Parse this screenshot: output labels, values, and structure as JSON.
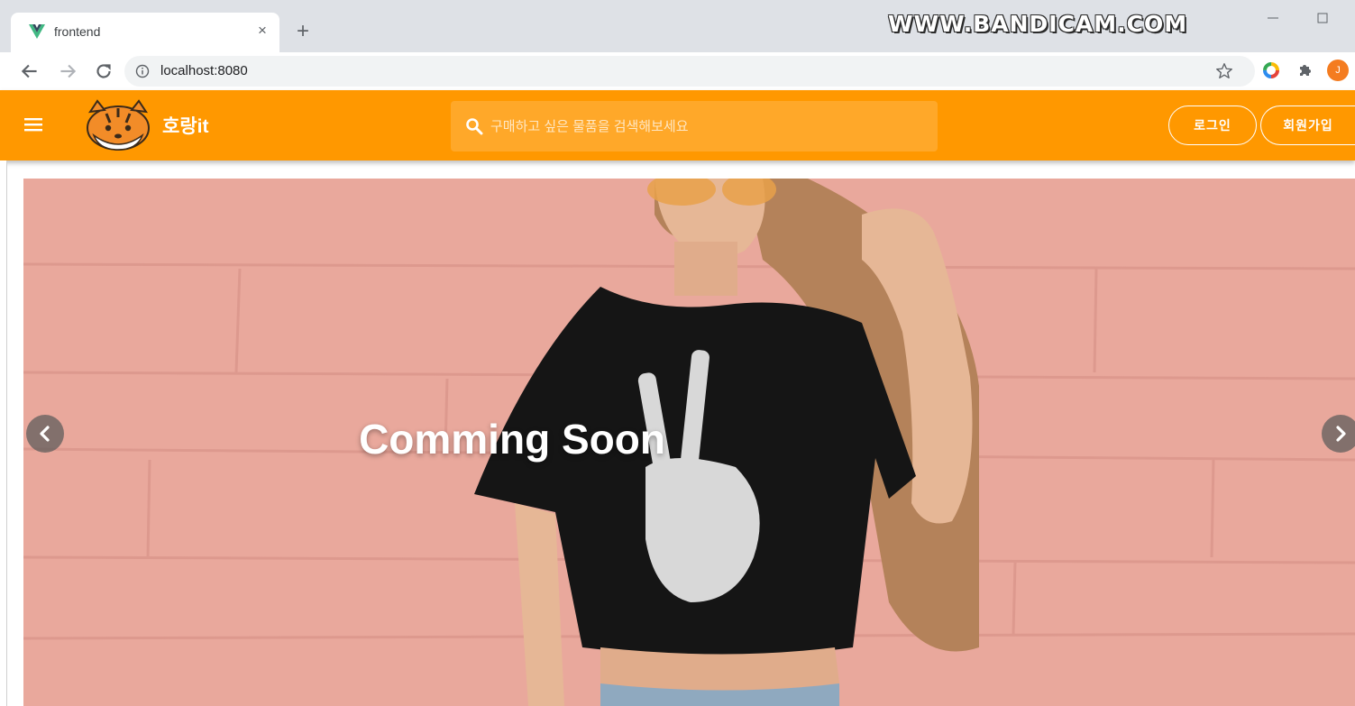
{
  "browser": {
    "tab_title": "frontend",
    "url": "localhost:8080",
    "close_glyph": "×",
    "new_tab_glyph": "+",
    "profile_initial": "J",
    "watermark": "WWW.BANDICAM.COM"
  },
  "header": {
    "brand": "호랑it",
    "search_placeholder": "구매하고 싶은 물품을 검색해보세요",
    "login_label": "로그인",
    "signup_label": "회원가입",
    "color": "#ff9800"
  },
  "carousel": {
    "caption": "Comming Soon"
  },
  "icons": [
    "vue-favicon-icon",
    "back-arrow-icon",
    "forward-arrow-icon",
    "reload-icon",
    "info-icon",
    "star-icon",
    "color-wheel-icon",
    "puzzle-icon",
    "hamburger-icon",
    "tiger-logo-icon",
    "search-icon",
    "chevron-left-icon",
    "chevron-right-icon"
  ]
}
